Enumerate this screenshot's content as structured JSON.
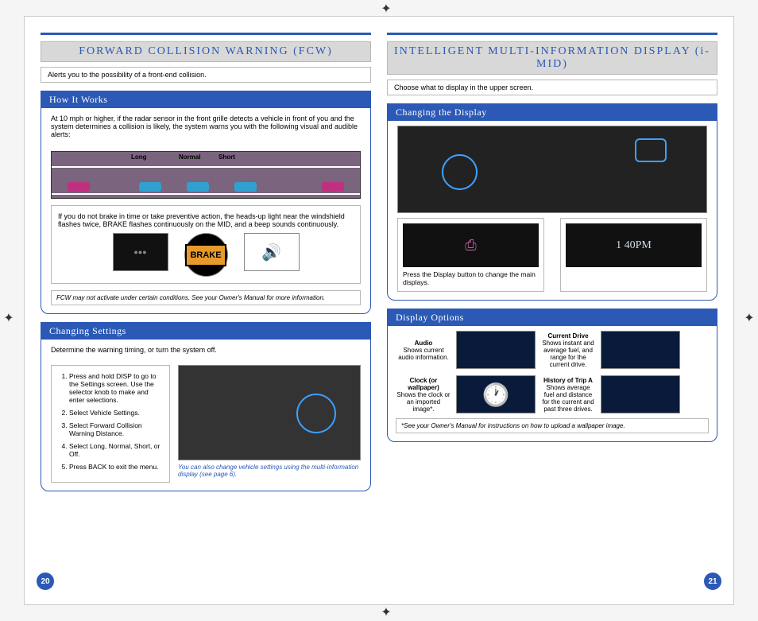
{
  "left": {
    "title": "FORWARD COLLISION WARNING (FCW)",
    "intro": "Alerts you to the possibility of a front-end collision.",
    "howHead": "How It Works",
    "howText": "At 10 mph or higher, if the radar sensor in the front grille detects a vehicle in front of you and the system determines a collision is likely, the system warns you with the following visual and audible alerts:",
    "labels": {
      "long": "Long",
      "normal": "Normal",
      "short": "Short"
    },
    "warnText": "If you do not brake in time or take preventive action, the heads-up light near the windshield flashes twice, BRAKE flashes continuously on the MID, and a beep sounds continuously.",
    "brake": "BRAKE",
    "footnote": "FCW may not activate under certain conditions. See your Owner's Manual for more information.",
    "settingsHead": "Changing Settings",
    "settingsIntro": "Determine the warning timing, or turn the system off.",
    "steps": [
      "Press and hold DISP to go to the Settings screen. Use the selector knob to make and enter selections.",
      "Select Vehicle Settings.",
      "Select Forward Collision Warning Distance.",
      "Select Long, Normal, Short, or Off.",
      "Press BACK to exit the menu."
    ],
    "settingsCaption": "You can also change vehicle settings using the multi-information display (see page 6).",
    "pageNum": "20"
  },
  "right": {
    "title": "INTELLIGENT MULTI-INFORMATION DISPLAY (i-MID)",
    "intro": "Choose what to display in the upper screen.",
    "changeHead": "Changing the Display",
    "pressText": "Press the Display button to change the main displays.",
    "clockText": "1 40PM",
    "optsHead": "Display Options",
    "opts": {
      "audio": {
        "t": "Audio",
        "d": "Shows current audio information."
      },
      "drive": {
        "t": "Current Drive",
        "d": "Shows instant and average fuel, and range for the current drive."
      },
      "clock": {
        "t": "Clock (or wallpaper)",
        "d": "Shows the clock or an imported image*."
      },
      "hist": {
        "t": "History of Trip A",
        "d": "Shows average fuel and distance for the current and past three drives."
      }
    },
    "optsFoot": "*See your Owner's Manual for instructions on how to upload a wallpaper image.",
    "pageNum": "21"
  }
}
